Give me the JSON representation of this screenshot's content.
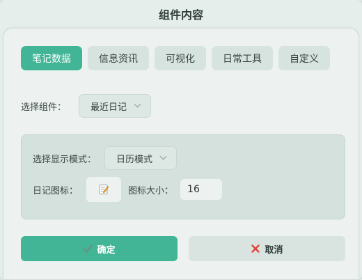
{
  "dialog": {
    "title": "组件内容"
  },
  "tabs": [
    {
      "label": "笔记数据",
      "active": true
    },
    {
      "label": "信息资讯",
      "active": false
    },
    {
      "label": "可视化",
      "active": false
    },
    {
      "label": "日常工具",
      "active": false
    },
    {
      "label": "自定义",
      "active": false
    }
  ],
  "component_select": {
    "label": "选择组件：",
    "value": "最近日记"
  },
  "display_mode": {
    "label": "选择显示模式：",
    "value": "日历模式"
  },
  "diary_icon": {
    "label": "日记图标：",
    "icon": "memo-icon"
  },
  "icon_size": {
    "label": "图标大小：",
    "value": "16"
  },
  "buttons": {
    "confirm": {
      "label": "确定",
      "icon": "check-icon"
    },
    "cancel": {
      "label": "取消",
      "icon": "close-icon"
    }
  },
  "colors": {
    "accent": "#41b596",
    "cancel_x": "#e0413a",
    "check": "#6f8d80"
  }
}
